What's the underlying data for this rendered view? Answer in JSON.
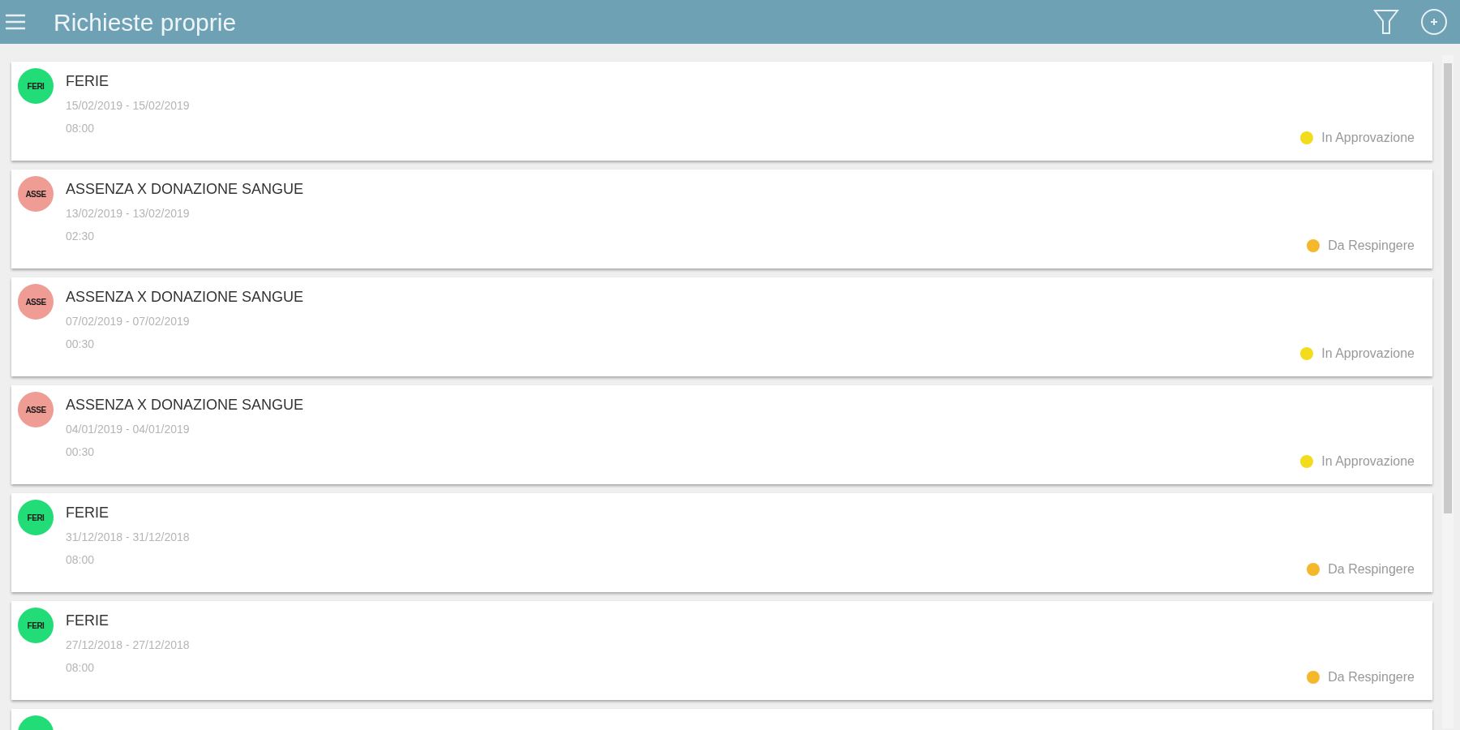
{
  "header": {
    "title": "Richieste proprie"
  },
  "requests": [
    {
      "avatar": {
        "text": "FERI",
        "color": "#22dd77"
      },
      "title": "FERIE",
      "dates": "15/02/2019 - 15/02/2019",
      "hours": "08:00",
      "status": {
        "text": "In Approvazione",
        "color": "#f2dc1c"
      }
    },
    {
      "avatar": {
        "text": "ASSE",
        "color": "#ee9c94"
      },
      "title": "ASSENZA X DONAZIONE SANGUE",
      "dates": "13/02/2019 - 13/02/2019",
      "hours": "02:30",
      "status": {
        "text": "Da Respingere",
        "color": "#f5b82a"
      }
    },
    {
      "avatar": {
        "text": "ASSE",
        "color": "#ee9c94"
      },
      "title": "ASSENZA X DONAZIONE SANGUE",
      "dates": "07/02/2019 - 07/02/2019",
      "hours": "00:30",
      "status": {
        "text": "In Approvazione",
        "color": "#f2dc1c"
      }
    },
    {
      "avatar": {
        "text": "ASSE",
        "color": "#ee9c94"
      },
      "title": "ASSENZA X DONAZIONE SANGUE",
      "dates": "04/01/2019 - 04/01/2019",
      "hours": "00:30",
      "status": {
        "text": "In Approvazione",
        "color": "#f2dc1c"
      }
    },
    {
      "avatar": {
        "text": "FERI",
        "color": "#22dd77"
      },
      "title": "FERIE",
      "dates": "31/12/2018 - 31/12/2018",
      "hours": "08:00",
      "status": {
        "text": "Da Respingere",
        "color": "#f5b82a"
      }
    },
    {
      "avatar": {
        "text": "FERI",
        "color": "#22dd77"
      },
      "title": "FERIE",
      "dates": "27/12/2018 - 27/12/2018",
      "hours": "08:00",
      "status": {
        "text": "Da Respingere",
        "color": "#f5b82a"
      }
    },
    {
      "avatar": {
        "color": "#22dd77"
      }
    }
  ]
}
